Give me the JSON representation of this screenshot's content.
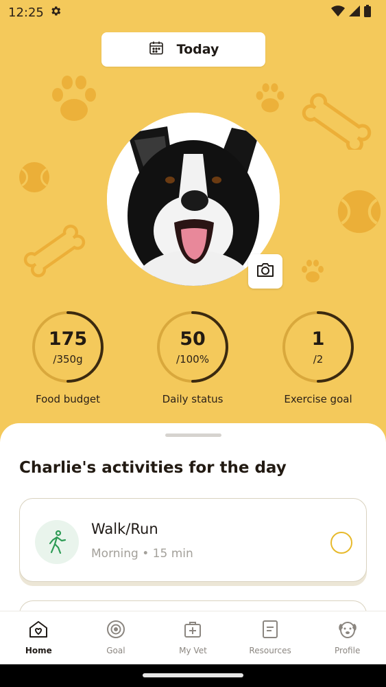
{
  "status_bar": {
    "time": "12:25",
    "icons": [
      "gear-icon",
      "wifi-icon",
      "signal-icon",
      "battery-icon"
    ]
  },
  "date_selector": {
    "label": "Today",
    "icon": "calendar-icon"
  },
  "pet_photo": {
    "icon": "camera-icon"
  },
  "stats": [
    {
      "value": "175",
      "sub": "/350g",
      "caption": "Food budget",
      "progress": 0.5
    },
    {
      "value": "50",
      "sub": "/100%",
      "caption": "Daily status",
      "progress": 0.5
    },
    {
      "value": "1",
      "sub": "/2",
      "caption": "Exercise goal",
      "progress": 0.5
    }
  ],
  "activities": {
    "title": "Charlie's activities for the day",
    "items": [
      {
        "title": "Walk/Run",
        "subtitle": "Morning • 15 min",
        "icon": "walk-icon",
        "done": false
      }
    ]
  },
  "nav": {
    "items": [
      {
        "label": "Home",
        "icon": "home-heart-icon",
        "active": true
      },
      {
        "label": "Goal",
        "icon": "target-icon",
        "active": false
      },
      {
        "label": "My Vet",
        "icon": "vet-kit-icon",
        "active": false
      },
      {
        "label": "Resources",
        "icon": "document-icon",
        "active": false
      },
      {
        "label": "Profile",
        "icon": "dog-face-icon",
        "active": false
      }
    ]
  },
  "colors": {
    "background": "#f4c95b",
    "ring_track": "#d9a83c",
    "ring_progress": "#3b2a10",
    "check_ring": "#e7b92a",
    "walk_icon": "#2e9b55"
  }
}
